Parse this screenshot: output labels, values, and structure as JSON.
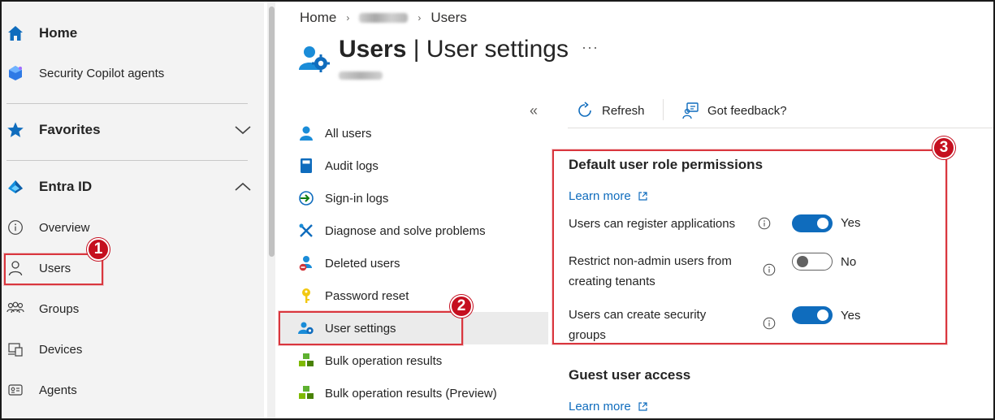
{
  "leftnav": {
    "home": "Home",
    "copilot": "Security Copilot agents",
    "favorites": "Favorites",
    "entra": "Entra ID",
    "items": [
      {
        "label": "Overview",
        "icon": "info-icon"
      },
      {
        "label": "Users",
        "icon": "person-icon"
      },
      {
        "label": "Groups",
        "icon": "people-group-icon"
      },
      {
        "label": "Devices",
        "icon": "devices-icon"
      },
      {
        "label": "Agents",
        "icon": "agent-card-icon"
      }
    ]
  },
  "breadcrumb": {
    "home": "Home",
    "users": "Users"
  },
  "header": {
    "title_bold": "Users",
    "title_sep": " | ",
    "title_rest": "User settings",
    "more": "···"
  },
  "subnav": {
    "collapse": "«",
    "items": [
      {
        "label": "All users",
        "icon": "person-icon"
      },
      {
        "label": "Audit logs",
        "icon": "book-icon"
      },
      {
        "label": "Sign-in logs",
        "icon": "sign-in-icon"
      },
      {
        "label": "Diagnose and solve problems",
        "icon": "wrench-icon"
      },
      {
        "label": "Deleted users",
        "icon": "deleted-user-icon"
      },
      {
        "label": "Password reset",
        "icon": "key-icon"
      },
      {
        "label": "User settings",
        "icon": "user-settings-icon"
      },
      {
        "label": "Bulk operation results",
        "icon": "bulk-icon"
      },
      {
        "label": "Bulk operation results (Preview)",
        "icon": "bulk-icon"
      }
    ]
  },
  "toolbar": {
    "refresh": "Refresh",
    "feedback": "Got feedback?"
  },
  "content": {
    "section1_title": "Default user role permissions",
    "learn_more": "Learn more",
    "settings": [
      {
        "label": "Users can register applications",
        "value": "Yes",
        "on": true
      },
      {
        "label": "Restrict non-admin users from creating tenants",
        "value": "No",
        "on": false
      },
      {
        "label": "Users can create security groups",
        "value": "Yes",
        "on": true
      }
    ],
    "section2_title": "Guest user access",
    "learn_more2": "Learn more"
  },
  "annotations": [
    "1",
    "2",
    "3"
  ],
  "colors": {
    "accent": "#0f6cbd",
    "annotation": "#c50f1f",
    "nav_bg": "#f3f3f3"
  }
}
